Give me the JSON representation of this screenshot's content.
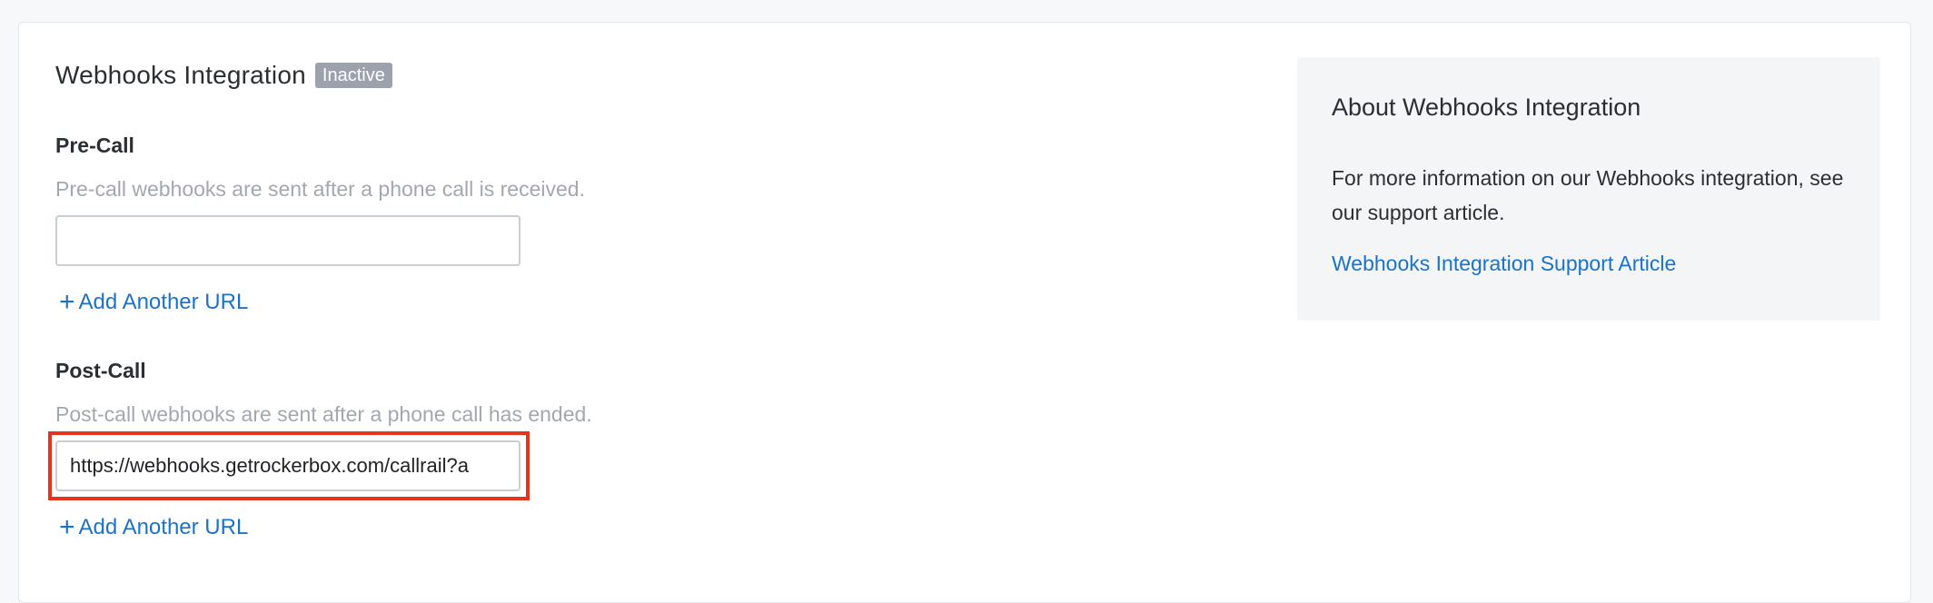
{
  "integration": {
    "title": "Webhooks Integration",
    "status_badge": "Inactive"
  },
  "pre_call": {
    "label": "Pre-Call",
    "help": "Pre-call webhooks are sent after a phone call is received.",
    "url_value": "",
    "add_link": "Add Another URL"
  },
  "post_call": {
    "label": "Post-Call",
    "help": "Post-call webhooks are sent after a phone call has ended.",
    "url_value": "https://webhooks.getrockerbox.com/callrail?a",
    "add_link": "Add Another URL"
  },
  "about": {
    "title": "About Webhooks Integration",
    "body": "For more information on our Webhooks integration, see our support article.",
    "link": "Webhooks Integration Support Article"
  },
  "colors": {
    "accent_link": "#1a73c9",
    "badge_bg": "#9ba2ad",
    "highlight": "#e8331c"
  }
}
